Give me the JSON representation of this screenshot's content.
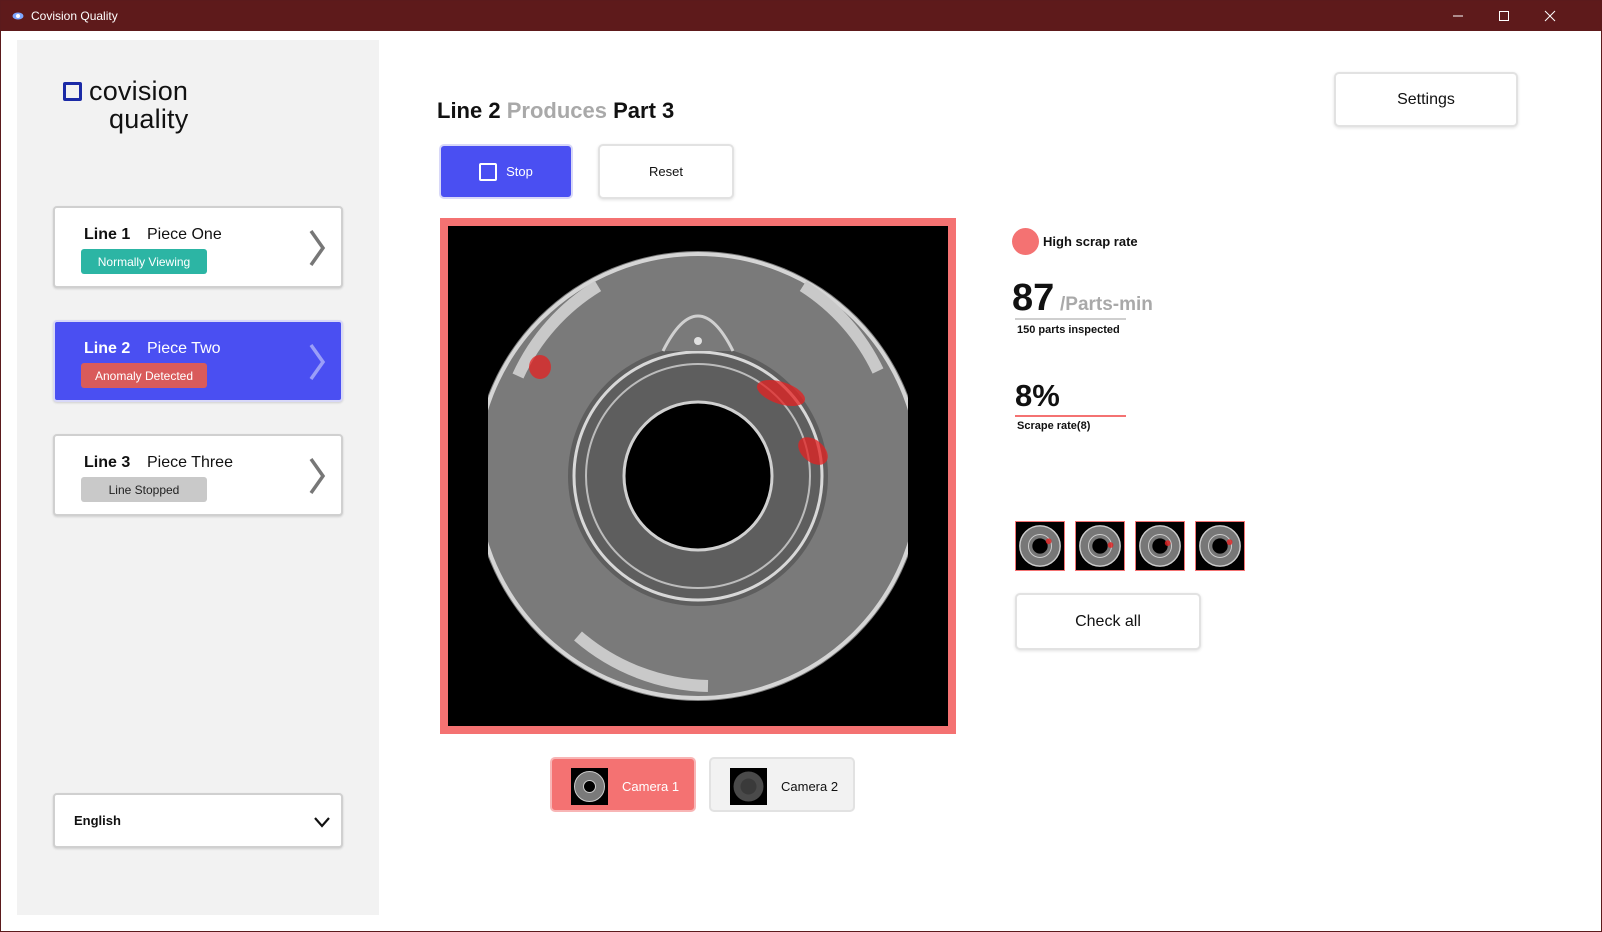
{
  "window": {
    "title": "Covision Quality"
  },
  "brand": {
    "word1": "covision",
    "word2": "quality",
    "accent": "#1b2aa6"
  },
  "lines": [
    {
      "line": "Line 1",
      "piece": "Piece One",
      "status": "Normally Viewing",
      "status_color": "#2cb5a4",
      "active": false
    },
    {
      "line": "Line 2",
      "piece": "Piece Two",
      "status": "Anomaly Detected",
      "status_color": "#d95b5b",
      "active": true
    },
    {
      "line": "Line 3",
      "piece": "Piece Three",
      "status": "Line Stopped",
      "status_color": "#c9c9c9",
      "active": false
    }
  ],
  "language": {
    "selected": "English"
  },
  "header": {
    "line": "Line 2",
    "verb": "Produces",
    "part": "Part 3"
  },
  "buttons": {
    "settings": "Settings",
    "stop": "Stop",
    "reset": "Reset",
    "check_all": "Check all"
  },
  "cameras": [
    {
      "label": "Camera 1",
      "active": true
    },
    {
      "label": "Camera 2",
      "active": false
    }
  ],
  "alert": {
    "label": "High scrap rate",
    "color": "#f47272"
  },
  "throughput": {
    "value": "87",
    "unit": "/Parts-min",
    "caption": "150 parts inspected"
  },
  "scrap": {
    "value": "8%",
    "caption": "Scrape rate(8)"
  },
  "colors": {
    "titlebar": "#5e1a1b",
    "primary": "#4a4ff2",
    "alert": "#f47272",
    "sidebar": "#f2f2f2"
  },
  "icons": [
    "app-icon",
    "minimize-icon",
    "maximize-icon",
    "close-icon",
    "chevron-right-icon",
    "chevron-down-icon",
    "stop-icon"
  ]
}
